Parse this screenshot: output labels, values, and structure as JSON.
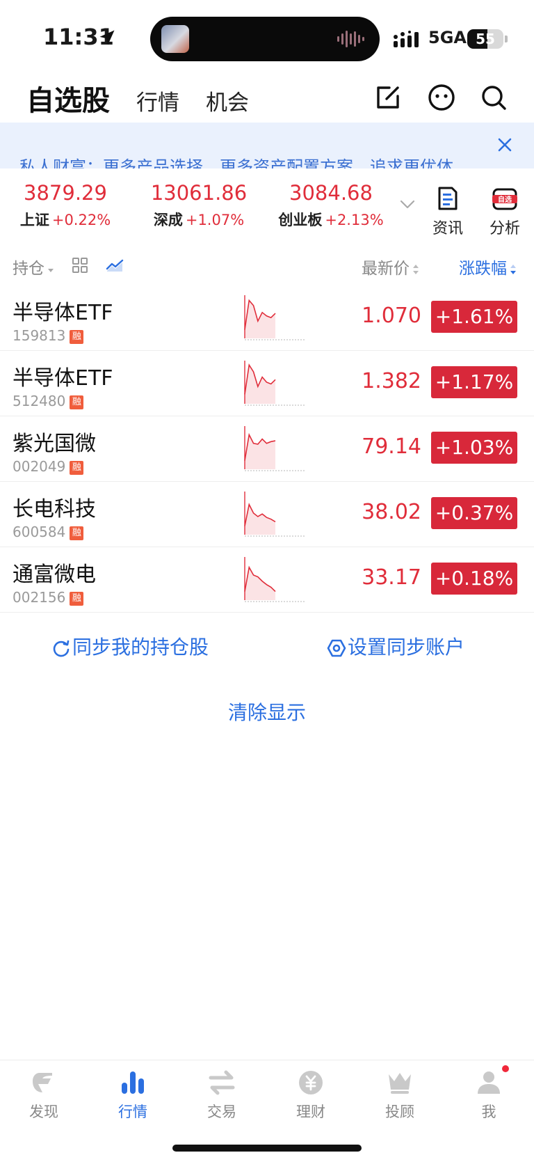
{
  "status_bar": {
    "time": "11:31",
    "network": "5GA",
    "battery_level": 55,
    "battery_text": "55"
  },
  "nav": {
    "title": "自选股",
    "tabs": [
      {
        "label": "行情"
      },
      {
        "label": "机会"
      }
    ]
  },
  "banner": {
    "text": "私人财富：更多产品选择，更多资产配置方案，追求更优体"
  },
  "indices": [
    {
      "name": "上证",
      "value": "3879.29",
      "change": "+0.22%"
    },
    {
      "name": "深成",
      "value": "13061.86",
      "change": "+1.07%"
    },
    {
      "name": "创业板",
      "value": "3084.68",
      "change": "+2.13%"
    }
  ],
  "tools": [
    {
      "label": "资讯"
    },
    {
      "label": "分析",
      "badge": "自选"
    }
  ],
  "list_header": {
    "holdings": "持仓",
    "price": "最新价",
    "change": "涨跌幅"
  },
  "badge_label": "融",
  "stocks": [
    {
      "name": "半导体ETF",
      "code": "159813",
      "price": "1.070",
      "change": "+1.61%",
      "trend": [
        20,
        88,
        76,
        40,
        60,
        52,
        48,
        58
      ]
    },
    {
      "name": "半导体ETF",
      "code": "512480",
      "price": "1.382",
      "change": "+1.17%",
      "trend": [
        22,
        90,
        74,
        40,
        62,
        50,
        46,
        56
      ]
    },
    {
      "name": "紫光国微",
      "code": "002049",
      "price": "79.14",
      "change": "+1.03%",
      "trend": [
        20,
        80,
        60,
        58,
        70,
        60,
        64,
        66
      ]
    },
    {
      "name": "长电科技",
      "code": "600584",
      "price": "38.02",
      "change": "+0.37%",
      "trend": [
        20,
        70,
        50,
        42,
        48,
        40,
        36,
        30
      ]
    },
    {
      "name": "通富微电",
      "code": "002156",
      "price": "33.17",
      "change": "+0.18%",
      "trend": [
        20,
        76,
        58,
        54,
        44,
        36,
        30,
        20
      ]
    }
  ],
  "actions": {
    "sync_holdings": "同步我的持仓股",
    "sync_account": "设置同步账户",
    "clear_display": "清除显示"
  },
  "tabbar": [
    {
      "label": "发现",
      "icon": "discover-icon"
    },
    {
      "label": "行情",
      "icon": "market-icon",
      "active": true
    },
    {
      "label": "交易",
      "icon": "trade-icon"
    },
    {
      "label": "理财",
      "icon": "wealth-icon"
    },
    {
      "label": "投顾",
      "icon": "advisor-icon"
    },
    {
      "label": "我",
      "icon": "profile-icon",
      "notification_dot": true
    }
  ],
  "colors": {
    "up_red": "#e02d3a",
    "chip_red": "#d8283a",
    "accent_blue": "#2b6fe0",
    "banner_bg": "#eaf1fd"
  }
}
